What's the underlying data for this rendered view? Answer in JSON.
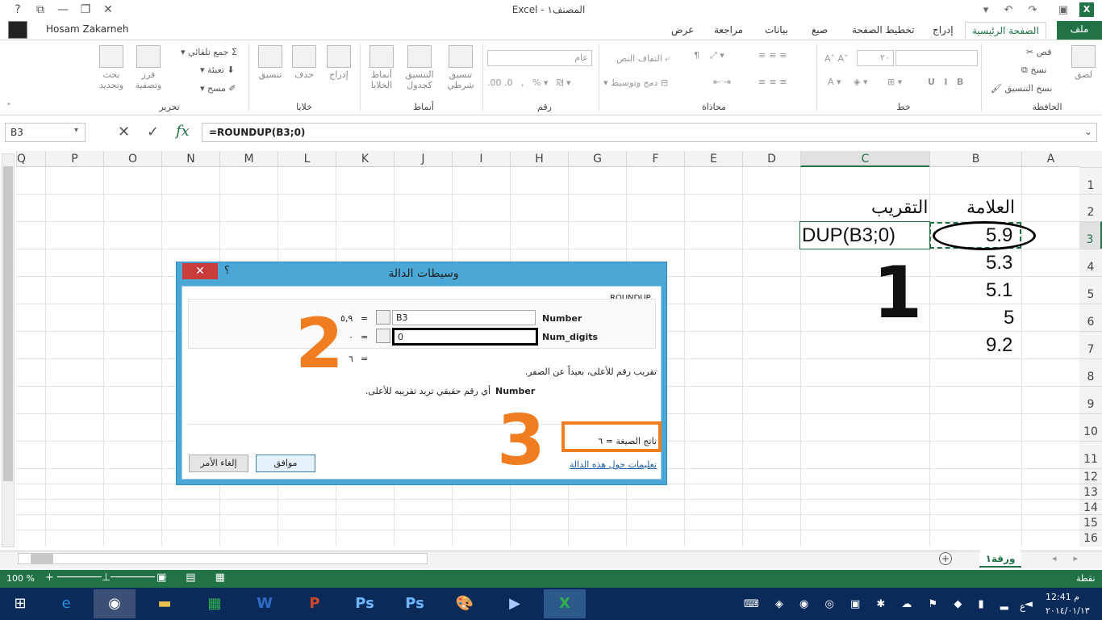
{
  "window": {
    "title": "Excel - المصنف١",
    "user": "Hosam Zakarneh"
  },
  "tabs": [
    "ملف",
    "الصفحة الرئيسية",
    "إدراج",
    "تخطيط الصفحة",
    "صيغ",
    "بيانات",
    "مراجعة",
    "عرض"
  ],
  "ribbon": {
    "clipboard": {
      "paste": "لصق",
      "cut": "قص",
      "copy": "نسخ",
      "format_painter": "نسخ التنسيق",
      "label": "الحافظة"
    },
    "font": {
      "size": "٢٠",
      "label": "خط"
    },
    "alignment": {
      "wrap": "التفاف النص",
      "merge": "دمج وتوسيط",
      "label": "محاذاة"
    },
    "number": {
      "format": "عام",
      "label": "رقم"
    },
    "styles": {
      "conditional": "تنسيق شرطي",
      "as_table": "التنسيق كجدول",
      "cell_styles": "أنماط الخلايا",
      "label": "أنماط"
    },
    "cells": {
      "insert": "إدراج",
      "delete": "حذف",
      "format": "تنسيق",
      "label": "خلايا"
    },
    "editing": {
      "autosum": "جمع تلقائي",
      "fill": "تعبئة",
      "clear": "مسح",
      "sort": "فرز وتصفية",
      "find": "بحث وتحديد",
      "label": "تحرير"
    }
  },
  "formula_bar": {
    "name_box": "B3",
    "formula": "=ROUNDUP(B3;0)"
  },
  "columns": [
    "A",
    "B",
    "C",
    "D",
    "E",
    "F",
    "G",
    "H",
    "I",
    "J",
    "K",
    "L",
    "M",
    "N",
    "O",
    "P",
    "Q"
  ],
  "rows": [
    "1",
    "2",
    "3",
    "4",
    "5",
    "6",
    "7",
    "8",
    "9",
    "10",
    "11",
    "12",
    "13",
    "14",
    "15",
    "16"
  ],
  "cells": {
    "b2": "العلامة",
    "c2": "التقريب",
    "b3": "5.9",
    "b4": "5.3",
    "b5": "5.1",
    "b6": "5",
    "b7": "9.2",
    "c3": "DUP(B3;0)"
  },
  "annotation_1": "1",
  "dialog": {
    "title": "وسيطات الدالة",
    "help": "؟",
    "function_name": "ROUNDUP",
    "arg1_name": "Number",
    "arg1_value": "B3",
    "arg1_result": "٥,٩",
    "arg2_name": "Num_digits",
    "arg2_value": "0",
    "arg2_result": "٠",
    "total_result": "٦",
    "equals": "=",
    "description": "تقريب رقم للأعلى، بعيداً عن الصفر.",
    "arg_desc_name": "Number",
    "arg_desc": "أي رقم حقيقي تريد تقريبه للأعلى.",
    "formula_result": "ناتج الصيغة = ٦",
    "help_link": "تعليمات حول هذه الدالة",
    "ok": "موافق",
    "cancel": "إلغاء الأمر",
    "annotation_2": "2",
    "annotation_3": "3"
  },
  "sheet_tab": "ورقة١",
  "status": {
    "mode": "نقطة",
    "zoom": "100 %"
  },
  "tray": {
    "time": "12:41 م",
    "date": "٢٠١٤/٠١/١٣",
    "lang": "ع"
  }
}
